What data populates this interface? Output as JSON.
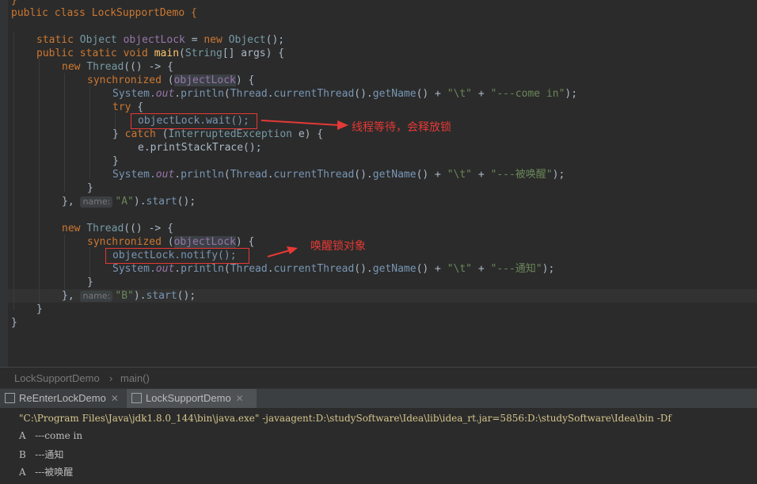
{
  "editor": {
    "lines": {
      "l1": "public class LockSupportDemo {",
      "l2a": "static",
      "l2b": "Object",
      "l2c": "objectLock",
      "l2d": " = ",
      "l2e": "new",
      "l2f": "Object",
      "l2g": "();",
      "l3": "public static void",
      "l3m": "main",
      "l3t": "String",
      "l3r": "[] args) {",
      "thread_kw": "new",
      "thread_type": "Thread",
      "thread_lambda": "(() -> {",
      "sync_kw": "synchronized",
      "sync_var": "objectLock",
      "system": "System.",
      "out": "out",
      "println": "println",
      "thread_call": "Thread",
      "current": "currentThread",
      "getname": "getName",
      "tab_str": "\"\\t\"",
      "come_in_str": "\"---come in\"",
      "try_kw": "try",
      "wait_call": "objectLock.wait();",
      "catch_kw": "catch",
      "exception": "InterruptedException",
      "catch_rest": " e) {",
      "print_trace": "e.printStackTrace();",
      "woken_str": "\"---被唤醒\"",
      "hint_name": "name:",
      "name_a": "\"A\"",
      "start": "start",
      "notify_call": "objectLock.notify();",
      "notify_str": "\"---通知\"",
      "name_b": "\"B\""
    },
    "annotations": {
      "wait_note": "线程等待，会释放锁",
      "notify_note": "唤醒锁对象"
    },
    "highlight_color": "#e53935"
  },
  "breadcrumb": {
    "class": "LockSupportDemo",
    "sep": "›",
    "method": "main()"
  },
  "run_tabs": [
    {
      "label": "ReEnterLockDemo",
      "active": false
    },
    {
      "label": "LockSupportDemo",
      "active": true
    }
  ],
  "console": {
    "command": "\"C:\\Program Files\\Java\\jdk1.8.0_144\\bin\\java.exe\" -javaagent:D:\\studySoftware\\Idea\\lib\\idea_rt.jar=5856:D:\\studySoftware\\Idea\\bin -Df",
    "out1": "A   ---come in",
    "out2": "B   ---通知",
    "out3": "A   ---被唤醒"
  }
}
